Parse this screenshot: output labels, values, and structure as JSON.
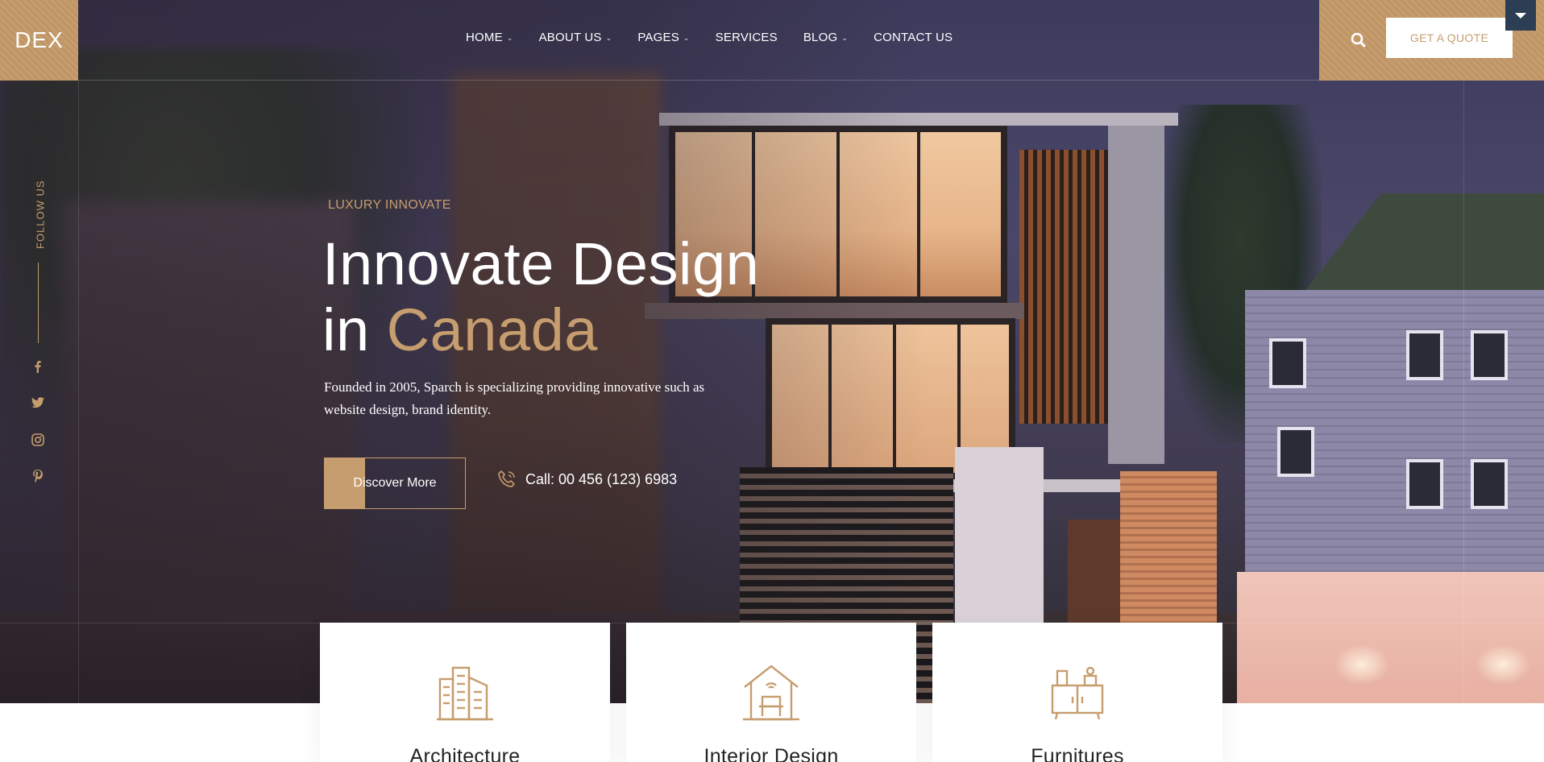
{
  "brand": {
    "logo": "DEX",
    "accent": "#c69d6e"
  },
  "nav": {
    "items": [
      {
        "label": "HOME",
        "has_dropdown": true
      },
      {
        "label": "ABOUT US",
        "has_dropdown": true
      },
      {
        "label": "PAGES",
        "has_dropdown": true
      },
      {
        "label": "SERVICES",
        "has_dropdown": false
      },
      {
        "label": "BLOG",
        "has_dropdown": true
      },
      {
        "label": "CONTACT US",
        "has_dropdown": false
      }
    ],
    "search_icon": "search-icon",
    "cta_label": "GET A QUOTE"
  },
  "sidebar": {
    "follow_label": "FOLLOW US",
    "social": [
      "facebook-icon",
      "twitter-icon",
      "instagram-icon",
      "pinterest-icon"
    ]
  },
  "hero": {
    "eyebrow": "LUXURY INNOVATE",
    "title_line1": "Innovate Design",
    "title_line2_prefix": "in ",
    "title_line2_accent": "Canada",
    "lead": "Founded in 2005, Sparch is specializing providing innovative such as website design, brand identity.",
    "button_label": "Discover More",
    "call_label": "Call: 00 456 (123) 6983"
  },
  "services": [
    {
      "title": "Architecture",
      "icon": "building-icon"
    },
    {
      "title": "Interior Design",
      "icon": "home-interior-icon"
    },
    {
      "title": "Furnitures",
      "icon": "cabinet-icon"
    }
  ]
}
